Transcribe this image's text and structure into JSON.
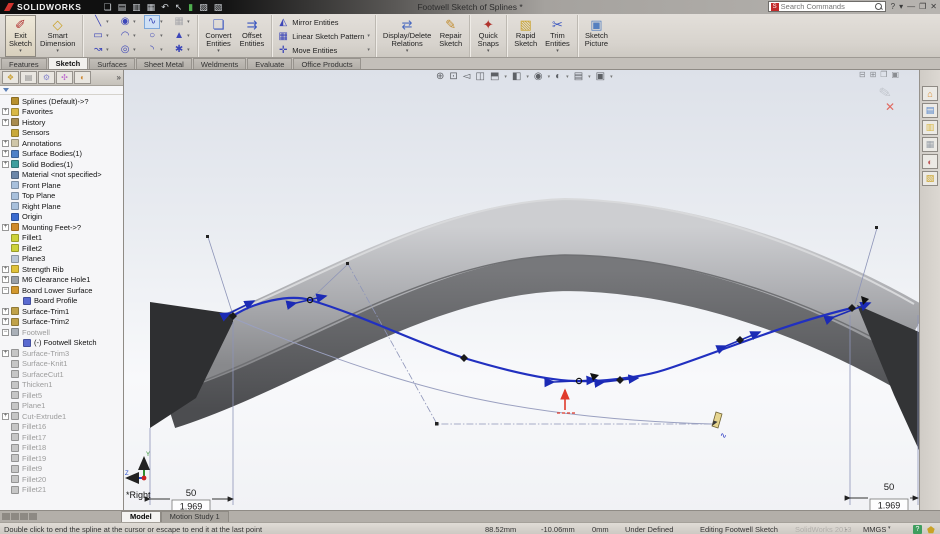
{
  "titlebar": {
    "logo_text": "SOLIDWORKS",
    "document_title": "Footwell Sketch of Splines *",
    "search_placeholder": "Search Commands",
    "window_controls": [
      {
        "name": "help-icon",
        "glyph": "?"
      },
      {
        "name": "help-dropdown-icon",
        "glyph": "▾"
      },
      {
        "name": "minimize-icon",
        "glyph": "—"
      },
      {
        "name": "restore-icon",
        "glyph": "❐"
      },
      {
        "name": "close-icon",
        "glyph": "✕"
      }
    ],
    "quick_access": [
      {
        "name": "new-file-icon",
        "glyph": "❏"
      },
      {
        "name": "open-file-icon",
        "glyph": "▤"
      },
      {
        "name": "save-icon",
        "glyph": "▥"
      },
      {
        "name": "print-icon",
        "glyph": "▦"
      },
      {
        "name": "undo-icon",
        "glyph": "↶"
      },
      {
        "name": "select-icon",
        "glyph": "↖"
      },
      {
        "name": "rebuild-icon",
        "glyph": "▮"
      },
      {
        "name": "options-icon",
        "glyph": "▨"
      },
      {
        "name": "file-properties-icon",
        "glyph": "▧"
      }
    ]
  },
  "ribbon": {
    "exit_sketch": "Exit\nSketch",
    "smart_dimension": "Smart\nDimension",
    "convert_entities": "Convert\nEntities",
    "offset_entities": "Offset\nEntities",
    "mirror_entities": "Mirror Entities",
    "linear_pattern": "Linear Sketch Pattern",
    "move_entities": "Move Entities",
    "display_delete": "Display/Delete\nRelations",
    "repair_sketch": "Repair\nSketch",
    "quick_snaps": "Quick\nSnaps",
    "rapid_sketch": "Rapid\nSketch",
    "trim_entities": "Trim\nEntities",
    "sketch_picture": "Sketch\nPicture",
    "entity_tools": [
      {
        "name": "line-tool-icon",
        "glyph": "╲",
        "state": ""
      },
      {
        "name": "circle-tool-icon",
        "glyph": "◉",
        "state": ""
      },
      {
        "name": "spline-tool-icon",
        "glyph": "∿",
        "state": "selected"
      },
      {
        "name": "sketch-pattern-tool-icon",
        "glyph": "▦",
        "state": "disabled"
      },
      {
        "name": "rectangle-tool-icon",
        "glyph": "▭",
        "state": ""
      },
      {
        "name": "arc-tool-icon",
        "glyph": "◠",
        "state": ""
      },
      {
        "name": "ellipse-tool-icon",
        "glyph": "○",
        "state": ""
      },
      {
        "name": "polygon-tool-icon",
        "glyph": "▲",
        "state": ""
      },
      {
        "name": "freeform-curve-tool-icon",
        "glyph": "↝",
        "state": ""
      },
      {
        "name": "perimeter-circle-tool-icon",
        "glyph": "◎",
        "state": ""
      },
      {
        "name": "fillet-arc-tool-icon",
        "glyph": "◝",
        "state": ""
      },
      {
        "name": "point-tool-icon",
        "glyph": "✱",
        "state": ""
      }
    ]
  },
  "command_tabs": [
    {
      "label": "Features",
      "active": false
    },
    {
      "label": "Sketch",
      "active": true
    },
    {
      "label": "Surfaces",
      "active": false
    },
    {
      "label": "Sheet Metal",
      "active": false
    },
    {
      "label": "Weldments",
      "active": false
    },
    {
      "label": "Evaluate",
      "active": false
    },
    {
      "label": "Office Products",
      "active": false
    }
  ],
  "headsup_icons": [
    {
      "name": "zoom-to-fit-icon",
      "glyph": "⊕",
      "caret": false
    },
    {
      "name": "zoom-to-area-icon",
      "glyph": "⊡",
      "caret": false
    },
    {
      "name": "previous-view-icon",
      "glyph": "◅",
      "caret": false
    },
    {
      "name": "section-view-icon",
      "glyph": "◫",
      "caret": false
    },
    {
      "name": "view-orientation-icon",
      "glyph": "⬒",
      "caret": true
    },
    {
      "name": "display-style-icon",
      "glyph": "◧",
      "caret": true
    },
    {
      "name": "hide-show-items-icon",
      "glyph": "◉",
      "caret": true
    },
    {
      "name": "edit-appearance-icon",
      "glyph": "◐",
      "caret": true
    },
    {
      "name": "apply-scene-icon",
      "glyph": "▤",
      "caret": true
    },
    {
      "name": "view-settings-icon",
      "glyph": "▣",
      "caret": true
    }
  ],
  "feature_tree": [
    {
      "label": "Splines  (Default)->?",
      "level": 0,
      "box": "",
      "color": "#b8912f",
      "gray": false
    },
    {
      "label": "Favorites",
      "level": 0,
      "box": "+",
      "color": "#d9b845",
      "gray": false
    },
    {
      "label": "History",
      "level": 0,
      "box": "+",
      "color": "#a98c4f",
      "gray": false
    },
    {
      "label": "Sensors",
      "level": 0,
      "box": "",
      "color": "#c9a93a",
      "gray": false
    },
    {
      "label": "Annotations",
      "level": 0,
      "box": "+",
      "color": "#cfc6a8",
      "gray": false
    },
    {
      "label": "Surface Bodies(1)",
      "level": 0,
      "box": "+",
      "color": "#4f81c8",
      "gray": false
    },
    {
      "label": "Solid Bodies(1)",
      "level": 0,
      "box": "+",
      "color": "#3f9f9f",
      "gray": false
    },
    {
      "label": "Material <not specified>",
      "level": 0,
      "box": "",
      "color": "#6b86a8",
      "gray": false
    },
    {
      "label": "Front Plane",
      "level": 0,
      "box": "",
      "color": "#a8c0dc",
      "gray": false
    },
    {
      "label": "Top Plane",
      "level": 0,
      "box": "",
      "color": "#a8c0dc",
      "gray": false
    },
    {
      "label": "Right Plane",
      "level": 0,
      "box": "",
      "color": "#a8c0dc",
      "gray": false
    },
    {
      "label": "Origin",
      "level": 0,
      "box": "",
      "color": "#3a6bd0",
      "gray": false
    },
    {
      "label": "Mounting Feet->?",
      "level": 0,
      "box": "+",
      "color": "#d08a2a",
      "gray": false
    },
    {
      "label": "Fillet1",
      "level": 0,
      "box": "",
      "color": "#cdd23a",
      "gray": false
    },
    {
      "label": "Fillet2",
      "level": 0,
      "box": "",
      "color": "#cdd23a",
      "gray": false
    },
    {
      "label": "Plane3",
      "level": 0,
      "box": "",
      "color": "#b9c6d6",
      "gray": false
    },
    {
      "label": "Strength Rib",
      "level": 0,
      "box": "+",
      "color": "#e0c23a",
      "gray": false
    },
    {
      "label": "M6 Clearance Hole1",
      "level": 0,
      "box": "+",
      "color": "#9aa0a8",
      "gray": false
    },
    {
      "label": "Board Lower Surface",
      "level": 0,
      "box": "-",
      "color": "#d2982f",
      "gray": false
    },
    {
      "label": "Board Profile",
      "level": 1,
      "box": "",
      "color": "#5a6ad0",
      "gray": false
    },
    {
      "label": "Surface-Trim1",
      "level": 0,
      "box": "+",
      "color": "#c0a24a",
      "gray": false
    },
    {
      "label": "Surface-Trim2",
      "level": 0,
      "box": "+",
      "color": "#c0a24a",
      "gray": false
    },
    {
      "label": "Footwell",
      "level": 0,
      "box": "-",
      "color": "#aab0b8",
      "gray": true
    },
    {
      "label": "(-) Footwell Sketch",
      "level": 1,
      "box": "",
      "color": "#5a6ad0",
      "gray": false
    },
    {
      "label": "Surface-Trim3",
      "level": 0,
      "box": "+",
      "color": "#c6c6c6",
      "gray": true
    },
    {
      "label": "Surface-Knit1",
      "level": 0,
      "box": "",
      "color": "#c6c6c6",
      "gray": true
    },
    {
      "label": "SurfaceCut1",
      "level": 0,
      "box": "",
      "color": "#c6c6c6",
      "gray": true
    },
    {
      "label": "Thicken1",
      "level": 0,
      "box": "",
      "color": "#c6c6c6",
      "gray": true
    },
    {
      "label": "Fillet5",
      "level": 0,
      "box": "",
      "color": "#c6c6c6",
      "gray": true
    },
    {
      "label": "Plane1",
      "level": 0,
      "box": "",
      "color": "#c6c6c6",
      "gray": true
    },
    {
      "label": "Cut-Extrude1",
      "level": 0,
      "box": "+",
      "color": "#c6c6c6",
      "gray": true
    },
    {
      "label": "Fillet16",
      "level": 0,
      "box": "",
      "color": "#c6c6c6",
      "gray": true
    },
    {
      "label": "Fillet17",
      "level": 0,
      "box": "",
      "color": "#c6c6c6",
      "gray": true
    },
    {
      "label": "Fillet18",
      "level": 0,
      "box": "",
      "color": "#c6c6c6",
      "gray": true
    },
    {
      "label": "Fillet19",
      "level": 0,
      "box": "",
      "color": "#c6c6c6",
      "gray": true
    },
    {
      "label": "Fillet9",
      "level": 0,
      "box": "",
      "color": "#c6c6c6",
      "gray": true
    },
    {
      "label": "Fillet20",
      "level": 0,
      "box": "",
      "color": "#c6c6c6",
      "gray": true
    },
    {
      "label": "Fillet21",
      "level": 0,
      "box": "",
      "color": "#c6c6c6",
      "gray": true
    }
  ],
  "viewport": {
    "orientation_label": "*Right",
    "dim_left": {
      "primary": "50",
      "secondary": "1.969"
    },
    "dim_right": {
      "primary": "50",
      "secondary": "1.969"
    },
    "colors": {
      "spline": "#2130c0",
      "construction": "#8d94b8",
      "deck_light": "#c6c7c9",
      "deck_mid": "#8e8f92",
      "deck_dark": "#2e2f31",
      "red_handle": "#e03a2a"
    }
  },
  "taskpane_icons": [
    {
      "name": "home-tab-icon",
      "glyph": "⌂",
      "color": "#d88a2a"
    },
    {
      "name": "design-library-tab-icon",
      "glyph": "▤",
      "color": "#4f81c8"
    },
    {
      "name": "file-explorer-tab-icon",
      "glyph": "▥",
      "color": "#d9b845"
    },
    {
      "name": "view-palette-tab-icon",
      "glyph": "▦",
      "color": "#9aa0a8"
    },
    {
      "name": "appearances-tab-icon",
      "glyph": "◐",
      "color": "#c05a5a"
    },
    {
      "name": "custom-properties-tab-icon",
      "glyph": "▧",
      "color": "#caa227"
    }
  ],
  "bottom_tabs": {
    "model": "Model",
    "motion": "Motion Study 1"
  },
  "statusbar": {
    "hint": "Double click to end the spline at the cursor or escape to end it at the last point",
    "x": "88.52mm",
    "y": "-10.06mm",
    "z": "0mm",
    "state": "Under Defined",
    "editing": "Editing Footwell Sketch",
    "watermark": "SolidWorks 2013",
    "dash": "-",
    "units": "MMGS"
  }
}
